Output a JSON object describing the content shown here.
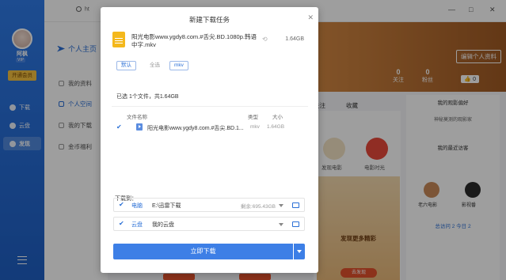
{
  "app": {
    "username": "阿枫",
    "vip_tag": "VIP",
    "vip_button": "开通会员",
    "nav": [
      {
        "label": "下载",
        "icon": "download-icon"
      },
      {
        "label": "云盘",
        "icon": "cloud-icon"
      },
      {
        "label": "发现",
        "icon": "discover-icon"
      }
    ]
  },
  "topbar": {
    "search_text": "ht",
    "minimize": "—",
    "maximize": "□",
    "close": "✕"
  },
  "profile": {
    "brand": "个人主页",
    "menu": [
      "我的资料",
      "个人空间",
      "我的下载",
      "金币福利"
    ],
    "edit_button": "编辑个人资料",
    "stats": [
      {
        "value": "0",
        "label": "关注"
      },
      {
        "value": "0",
        "label": "粉丝"
      }
    ],
    "like_count": "0",
    "tabs": [
      "关注",
      "收藏"
    ],
    "circles": [
      {
        "label": "发现电影"
      },
      {
        "label": "电影时光"
      }
    ],
    "promo_title": "发现更多精彩",
    "promo_button": "去发现",
    "right_title": "我的观影偏好",
    "right_sub": "神秘莫测的观影家",
    "recent_title": "我的最近访客",
    "visitors": [
      "老六电影",
      "影视番"
    ],
    "pager_prefix": "总访问",
    "pager_value": "2 今日 2"
  },
  "dialog": {
    "title": "新建下载任务",
    "close": "✕",
    "file_name": "阳光电影www.ygdy8.com.#舌尖.BD.1080p.韩语中字.mkv",
    "file_size": "1.64GB",
    "filters": [
      "默认",
      "全选",
      "mkv"
    ],
    "selection_info": "已选 1个文件，共1.64GB",
    "columns": {
      "name": "文件名称",
      "type": "类型",
      "size": "大小"
    },
    "row": {
      "name": "阳光电影www.ygdy8.com.#舌尖.BD.1...",
      "type": "mkv",
      "size": "1.64GB"
    },
    "download_to": "下载到：",
    "targets": [
      {
        "label": "电脑",
        "path": "E:\\迅雷下载",
        "space": "剩余:695.43GB"
      },
      {
        "label": "云盘",
        "path": "我的云盘",
        "space": ""
      }
    ],
    "primary_button": "立即下载"
  }
}
